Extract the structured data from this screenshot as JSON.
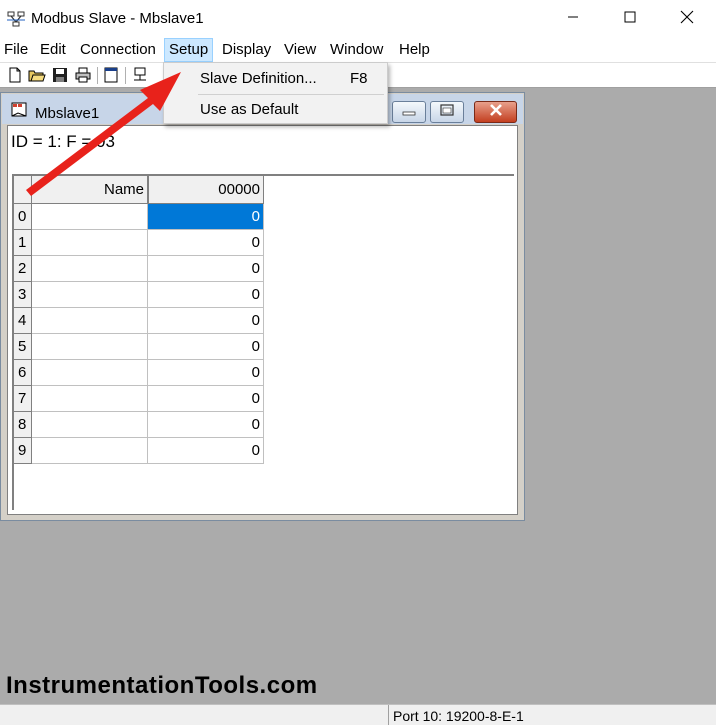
{
  "app": {
    "title": "Modbus Slave - Mbslave1",
    "icon": "modbus-slave-icon"
  },
  "menu": [
    {
      "label": "File"
    },
    {
      "label": "Edit"
    },
    {
      "label": "Connection"
    },
    {
      "label": "Setup",
      "active": true
    },
    {
      "label": "Display"
    },
    {
      "label": "View"
    },
    {
      "label": "Window"
    },
    {
      "label": "Help"
    }
  ],
  "toolbar": {
    "icons": [
      "new-file-icon",
      "open-folder-icon",
      "save-icon",
      "print-icon",
      "window-icon",
      "connect-icon"
    ]
  },
  "setup_menu": {
    "items": [
      {
        "label": "Slave Definition...",
        "shortcut": "F8",
        "highlighted": true
      },
      {
        "label": "Use as Default",
        "shortcut": ""
      }
    ]
  },
  "child_window": {
    "title": "Mbslave1",
    "status": "ID = 1: F = 03",
    "grid": {
      "corner": "",
      "columns": [
        "Name",
        "00000"
      ],
      "rows": [
        {
          "index": "0",
          "name": "",
          "value": "0",
          "selected": true
        },
        {
          "index": "1",
          "name": "",
          "value": "0"
        },
        {
          "index": "2",
          "name": "",
          "value": "0"
        },
        {
          "index": "3",
          "name": "",
          "value": "0"
        },
        {
          "index": "4",
          "name": "",
          "value": "0"
        },
        {
          "index": "5",
          "name": "",
          "value": "0"
        },
        {
          "index": "6",
          "name": "",
          "value": "0"
        },
        {
          "index": "7",
          "name": "",
          "value": "0"
        },
        {
          "index": "8",
          "name": "",
          "value": "0"
        },
        {
          "index": "9",
          "name": "",
          "value": "0"
        }
      ]
    }
  },
  "watermark": "InstrumentationTools.com",
  "statusbar": {
    "port": "Port 10: 19200-8-E-1"
  },
  "colors": {
    "selection": "#0078d7",
    "arrow": "#e8221b",
    "menu_active": "#cce8ff",
    "mdi_background": "#ababab"
  }
}
